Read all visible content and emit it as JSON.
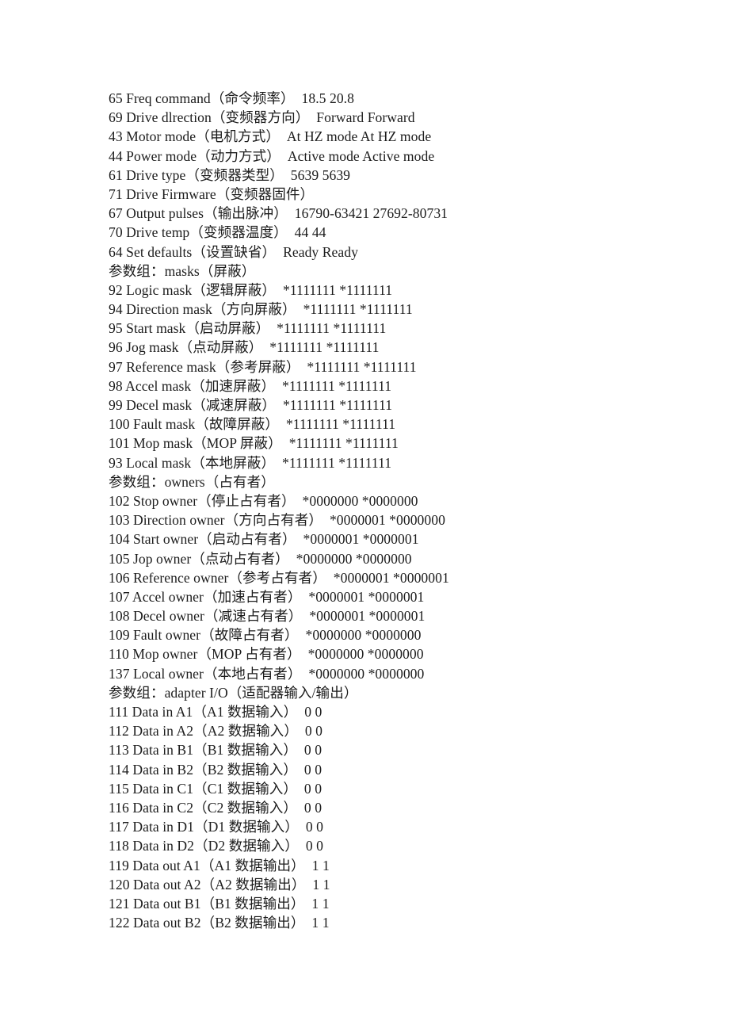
{
  "document": {
    "language": "zh-CN",
    "text_color": "#1c1c1c",
    "background_color": "#ffffff"
  },
  "lines": [
    {
      "type": "param",
      "text": "65 Freq command（命令频率）  18.5 20.8"
    },
    {
      "type": "param",
      "text": "69 Drive dlrection（变频器方向）  Forward Forward"
    },
    {
      "type": "param",
      "text": "43 Motor mode（电机方式）  At HZ mode At HZ mode"
    },
    {
      "type": "param",
      "text": "44 Power mode（动力方式）  Active mode Active mode"
    },
    {
      "type": "param",
      "text": "61 Drive type（变频器类型）  5639 5639"
    },
    {
      "type": "param",
      "text": "71 Drive Firmware（变频器固件）"
    },
    {
      "type": "param",
      "text": "67 Output pulses（输出脉冲）  16790-63421 27692-80731"
    },
    {
      "type": "param",
      "text": "70 Drive temp（变频器温度）  44 44"
    },
    {
      "type": "param",
      "text": "64 Set defaults（设置缺省）  Ready Ready"
    },
    {
      "type": "group",
      "text": "参数组：masks（屏蔽）"
    },
    {
      "type": "param",
      "text": "92 Logic mask（逻辑屏蔽）  *1111111 *1111111"
    },
    {
      "type": "param",
      "text": "94 Direction mask（方向屏蔽）  *1111111 *1111111"
    },
    {
      "type": "param",
      "text": "95 Start mask（启动屏蔽）  *1111111 *1111111"
    },
    {
      "type": "param",
      "text": "96 Jog mask（点动屏蔽）  *1111111 *1111111"
    },
    {
      "type": "param",
      "text": "97 Reference mask（参考屏蔽）  *1111111 *1111111"
    },
    {
      "type": "param",
      "text": "98 Accel mask（加速屏蔽）  *1111111 *1111111"
    },
    {
      "type": "param",
      "text": "99 Decel mask（减速屏蔽）  *1111111 *1111111"
    },
    {
      "type": "param",
      "text": "100 Fault mask（故障屏蔽）  *1111111 *1111111"
    },
    {
      "type": "param",
      "text": "101 Mop mask（MOP 屏蔽）  *1111111 *1111111"
    },
    {
      "type": "param",
      "text": "93 Local mask（本地屏蔽）  *1111111 *1111111"
    },
    {
      "type": "group",
      "text": "参数组：owners（占有者）"
    },
    {
      "type": "param",
      "text": "102 Stop owner（停止占有者）  *0000000 *0000000"
    },
    {
      "type": "param",
      "text": "103 Direction owner（方向占有者）  *0000001 *0000000"
    },
    {
      "type": "param",
      "text": "104 Start owner（启动占有者）  *0000001 *0000001"
    },
    {
      "type": "param",
      "text": "105 Jop owner（点动占有者）  *0000000 *0000000"
    },
    {
      "type": "param",
      "text": "106 Reference owner（参考占有者）  *0000001 *0000001"
    },
    {
      "type": "param",
      "text": "107 Accel owner（加速占有者）  *0000001 *0000001"
    },
    {
      "type": "param",
      "text": "108 Decel owner（减速占有者）  *0000001 *0000001"
    },
    {
      "type": "param",
      "text": "109 Fault owner（故障占有者）  *0000000 *0000000"
    },
    {
      "type": "param",
      "text": "110 Mop owner（MOP 占有者）  *0000000 *0000000"
    },
    {
      "type": "param",
      "text": "137 Local owner（本地占有者）  *0000000 *0000000"
    },
    {
      "type": "group",
      "text": "参数组：adapter I/O（适配器输入/输出）"
    },
    {
      "type": "param",
      "text": "111 Data in A1（A1 数据输入）  0 0"
    },
    {
      "type": "param",
      "text": "112 Data in A2（A2 数据输入）  0 0"
    },
    {
      "type": "param",
      "text": "113 Data in B1（B1 数据输入）  0 0"
    },
    {
      "type": "param",
      "text": "114 Data in B2（B2 数据输入）  0 0"
    },
    {
      "type": "param",
      "text": "115 Data in C1（C1 数据输入）  0 0"
    },
    {
      "type": "param",
      "text": "116 Data in C2（C2 数据输入）  0 0"
    },
    {
      "type": "param",
      "text": "117 Data in D1（D1 数据输入）  0 0"
    },
    {
      "type": "param",
      "text": "118 Data in D2（D2 数据输入）  0 0"
    },
    {
      "type": "param",
      "text": "119 Data out A1（A1 数据输出）  1 1"
    },
    {
      "type": "param",
      "text": "120 Data out A2（A2 数据输出）  1 1"
    },
    {
      "type": "param",
      "text": "121 Data out B1（B1 数据输出）  1 1"
    },
    {
      "type": "param",
      "text": "122 Data out B2（B2 数据输出）  1 1"
    }
  ],
  "parameters": [
    {
      "id": "65",
      "name_en": "Freq command",
      "name_cn": "命令频率",
      "values": [
        "18.5",
        "20.8"
      ],
      "group": ""
    },
    {
      "id": "69",
      "name_en": "Drive dlrection",
      "name_cn": "变频器方向",
      "values": [
        "Forward",
        "Forward"
      ],
      "group": ""
    },
    {
      "id": "43",
      "name_en": "Motor mode",
      "name_cn": "电机方式",
      "values": [
        "At HZ mode",
        "At HZ mode"
      ],
      "group": ""
    },
    {
      "id": "44",
      "name_en": "Power mode",
      "name_cn": "动力方式",
      "values": [
        "Active mode",
        "Active mode"
      ],
      "group": ""
    },
    {
      "id": "61",
      "name_en": "Drive type",
      "name_cn": "变频器类型",
      "values": [
        "5639",
        "5639"
      ],
      "group": ""
    },
    {
      "id": "71",
      "name_en": "Drive Firmware",
      "name_cn": "变频器固件",
      "values": [],
      "group": ""
    },
    {
      "id": "67",
      "name_en": "Output pulses",
      "name_cn": "输出脉冲",
      "values": [
        "16790-63421",
        "27692-80731"
      ],
      "group": ""
    },
    {
      "id": "70",
      "name_en": "Drive temp",
      "name_cn": "变频器温度",
      "values": [
        "44",
        "44"
      ],
      "group": ""
    },
    {
      "id": "64",
      "name_en": "Set defaults",
      "name_cn": "设置缺省",
      "values": [
        "Ready",
        "Ready"
      ],
      "group": ""
    },
    {
      "id": "92",
      "name_en": "Logic mask",
      "name_cn": "逻辑屏蔽",
      "values": [
        "*1111111",
        "*1111111"
      ],
      "group": "masks"
    },
    {
      "id": "94",
      "name_en": "Direction mask",
      "name_cn": "方向屏蔽",
      "values": [
        "*1111111",
        "*1111111"
      ],
      "group": "masks"
    },
    {
      "id": "95",
      "name_en": "Start mask",
      "name_cn": "启动屏蔽",
      "values": [
        "*1111111",
        "*1111111"
      ],
      "group": "masks"
    },
    {
      "id": "96",
      "name_en": "Jog mask",
      "name_cn": "点动屏蔽",
      "values": [
        "*1111111",
        "*1111111"
      ],
      "group": "masks"
    },
    {
      "id": "97",
      "name_en": "Reference mask",
      "name_cn": "参考屏蔽",
      "values": [
        "*1111111",
        "*1111111"
      ],
      "group": "masks"
    },
    {
      "id": "98",
      "name_en": "Accel mask",
      "name_cn": "加速屏蔽",
      "values": [
        "*1111111",
        "*1111111"
      ],
      "group": "masks"
    },
    {
      "id": "99",
      "name_en": "Decel mask",
      "name_cn": "减速屏蔽",
      "values": [
        "*1111111",
        "*1111111"
      ],
      "group": "masks"
    },
    {
      "id": "100",
      "name_en": "Fault mask",
      "name_cn": "故障屏蔽",
      "values": [
        "*1111111",
        "*1111111"
      ],
      "group": "masks"
    },
    {
      "id": "101",
      "name_en": "Mop mask",
      "name_cn": "MOP 屏蔽",
      "values": [
        "*1111111",
        "*1111111"
      ],
      "group": "masks"
    },
    {
      "id": "93",
      "name_en": "Local mask",
      "name_cn": "本地屏蔽",
      "values": [
        "*1111111",
        "*1111111"
      ],
      "group": "masks"
    },
    {
      "id": "102",
      "name_en": "Stop owner",
      "name_cn": "停止占有者",
      "values": [
        "*0000000",
        "*0000000"
      ],
      "group": "owners"
    },
    {
      "id": "103",
      "name_en": "Direction owner",
      "name_cn": "方向占有者",
      "values": [
        "*0000001",
        "*0000000"
      ],
      "group": "owners"
    },
    {
      "id": "104",
      "name_en": "Start owner",
      "name_cn": "启动占有者",
      "values": [
        "*0000001",
        "*0000001"
      ],
      "group": "owners"
    },
    {
      "id": "105",
      "name_en": "Jop owner",
      "name_cn": "点动占有者",
      "values": [
        "*0000000",
        "*0000000"
      ],
      "group": "owners"
    },
    {
      "id": "106",
      "name_en": "Reference owner",
      "name_cn": "参考占有者",
      "values": [
        "*0000001",
        "*0000001"
      ],
      "group": "owners"
    },
    {
      "id": "107",
      "name_en": "Accel owner",
      "name_cn": "加速占有者",
      "values": [
        "*0000001",
        "*0000001"
      ],
      "group": "owners"
    },
    {
      "id": "108",
      "name_en": "Decel owner",
      "name_cn": "减速占有者",
      "values": [
        "*0000001",
        "*0000001"
      ],
      "group": "owners"
    },
    {
      "id": "109",
      "name_en": "Fault owner",
      "name_cn": "故障占有者",
      "values": [
        "*0000000",
        "*0000000"
      ],
      "group": "owners"
    },
    {
      "id": "110",
      "name_en": "Mop owner",
      "name_cn": "MOP 占有者",
      "values": [
        "*0000000",
        "*0000000"
      ],
      "group": "owners"
    },
    {
      "id": "137",
      "name_en": "Local owner",
      "name_cn": "本地占有者",
      "values": [
        "*0000000",
        "*0000000"
      ],
      "group": "owners"
    },
    {
      "id": "111",
      "name_en": "Data in A1",
      "name_cn": "A1 数据输入",
      "values": [
        "0",
        "0"
      ],
      "group": "adapter I/O"
    },
    {
      "id": "112",
      "name_en": "Data in A2",
      "name_cn": "A2 数据输入",
      "values": [
        "0",
        "0"
      ],
      "group": "adapter I/O"
    },
    {
      "id": "113",
      "name_en": "Data in B1",
      "name_cn": "B1 数据输入",
      "values": [
        "0",
        "0"
      ],
      "group": "adapter I/O"
    },
    {
      "id": "114",
      "name_en": "Data in B2",
      "name_cn": "B2 数据输入",
      "values": [
        "0",
        "0"
      ],
      "group": "adapter I/O"
    },
    {
      "id": "115",
      "name_en": "Data in C1",
      "name_cn": "C1 数据输入",
      "values": [
        "0",
        "0"
      ],
      "group": "adapter I/O"
    },
    {
      "id": "116",
      "name_en": "Data in C2",
      "name_cn": "C2 数据输入",
      "values": [
        "0",
        "0"
      ],
      "group": "adapter I/O"
    },
    {
      "id": "117",
      "name_en": "Data in D1",
      "name_cn": "D1 数据输入",
      "values": [
        "0",
        "0"
      ],
      "group": "adapter I/O"
    },
    {
      "id": "118",
      "name_en": "Data in D2",
      "name_cn": "D2 数据输入",
      "values": [
        "0",
        "0"
      ],
      "group": "adapter I/O"
    },
    {
      "id": "119",
      "name_en": "Data out A1",
      "name_cn": "A1 数据输出",
      "values": [
        "1",
        "1"
      ],
      "group": "adapter I/O"
    },
    {
      "id": "120",
      "name_en": "Data out A2",
      "name_cn": "A2 数据输出",
      "values": [
        "1",
        "1"
      ],
      "group": "adapter I/O"
    },
    {
      "id": "121",
      "name_en": "Data out B1",
      "name_cn": "B1 数据输出",
      "values": [
        "1",
        "1"
      ],
      "group": "adapter I/O"
    },
    {
      "id": "122",
      "name_en": "Data out B2",
      "name_cn": "B2 数据输出",
      "values": [
        "1",
        "1"
      ],
      "group": "adapter I/O"
    }
  ],
  "groups": [
    {
      "label_cn": "参数组：",
      "name": "masks",
      "name_cn": "屏蔽"
    },
    {
      "label_cn": "参数组：",
      "name": "owners",
      "name_cn": "占有者"
    },
    {
      "label_cn": "参数组：",
      "name": "adapter I/O",
      "name_cn": "适配器输入/输出"
    }
  ]
}
